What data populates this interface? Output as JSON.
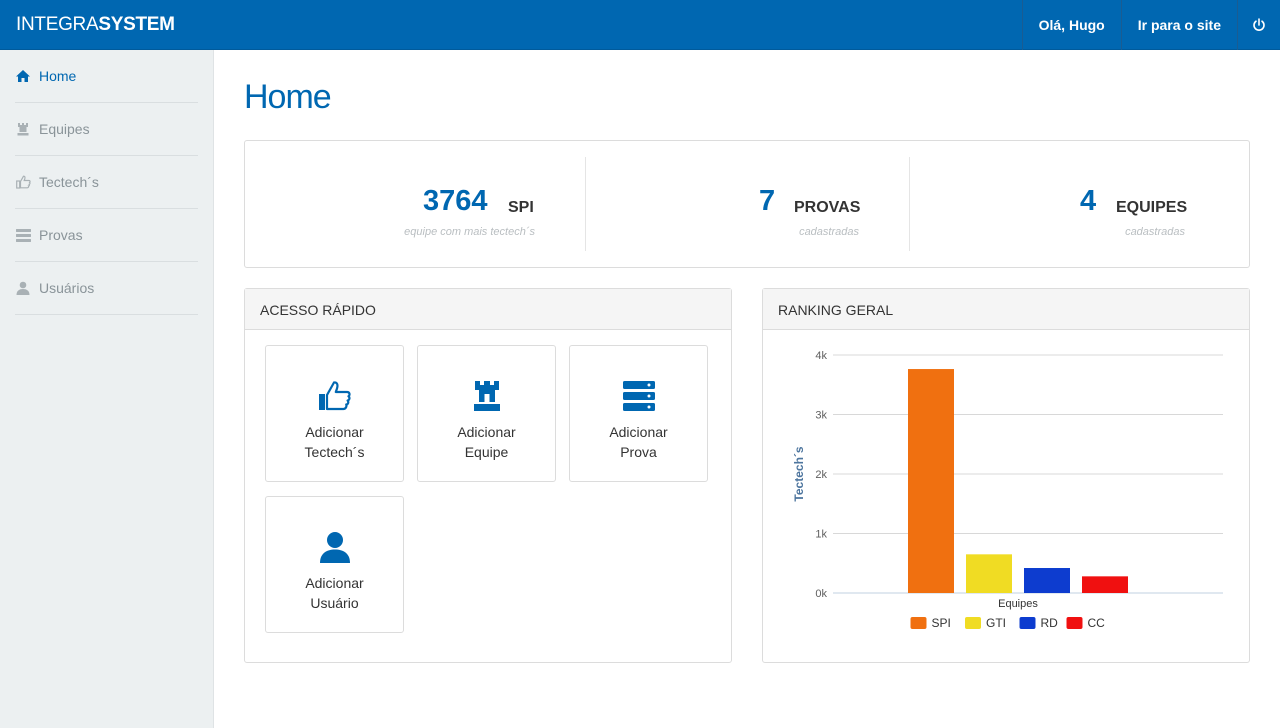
{
  "header": {
    "brand_light": "INTEGRA",
    "brand_bold": "SYSTEM",
    "greeting": "Olá, Hugo",
    "site_link": "Ir para o site",
    "power_icon": "power-icon"
  },
  "sidebar": {
    "items": [
      {
        "label": "Home",
        "icon": "home-icon",
        "active": true
      },
      {
        "label": "Equipes",
        "icon": "rook-icon",
        "active": false
      },
      {
        "label": "Tectech´s",
        "icon": "thumbs-up-icon",
        "active": false
      },
      {
        "label": "Provas",
        "icon": "list-icon",
        "active": false
      },
      {
        "label": "Usuários",
        "icon": "user-icon",
        "active": false
      }
    ]
  },
  "main": {
    "title": "Home",
    "stats": [
      {
        "value": "3764",
        "label": "SPI",
        "sub": "equipe com mais tectech´s"
      },
      {
        "value": "7",
        "label": "PROVAS",
        "sub": "cadastradas"
      },
      {
        "value": "4",
        "label": "EQUIPES",
        "sub": "cadastradas"
      }
    ],
    "quick_access": {
      "title": "ACESSO RÁPIDO",
      "tiles": [
        {
          "line1": "Adicionar",
          "line2": "Tectech´s",
          "icon": "thumbs-up-icon"
        },
        {
          "line1": "Adicionar",
          "line2": "Equipe",
          "icon": "rook-icon"
        },
        {
          "line1": "Adicionar",
          "line2": "Prova",
          "icon": "server-icon"
        },
        {
          "line1": "Adicionar",
          "line2": "Usuário",
          "icon": "user-icon"
        }
      ]
    },
    "ranking": {
      "title": "RANKING GERAL"
    }
  },
  "colors": {
    "primary": "#0067b1",
    "sidebar_bg": "#ecf0f1"
  },
  "chart_data": {
    "type": "bar",
    "categories": [
      "Equipes"
    ],
    "series": [
      {
        "name": "SPI",
        "values": [
          3764
        ],
        "color": "#f07010"
      },
      {
        "name": "GTI",
        "values": [
          650
        ],
        "color": "#f0dc23"
      },
      {
        "name": "RD",
        "values": [
          420
        ],
        "color": "#0d3ccf"
      },
      {
        "name": "CC",
        "values": [
          280
        ],
        "color": "#f01010"
      }
    ],
    "title": "",
    "xlabel": "",
    "ylabel": "Tectech´s",
    "yticks": [
      "0k",
      "1k",
      "2k",
      "3k",
      "4k"
    ],
    "ylim": [
      0,
      4000
    ],
    "grid": true,
    "legend": "bottom"
  }
}
